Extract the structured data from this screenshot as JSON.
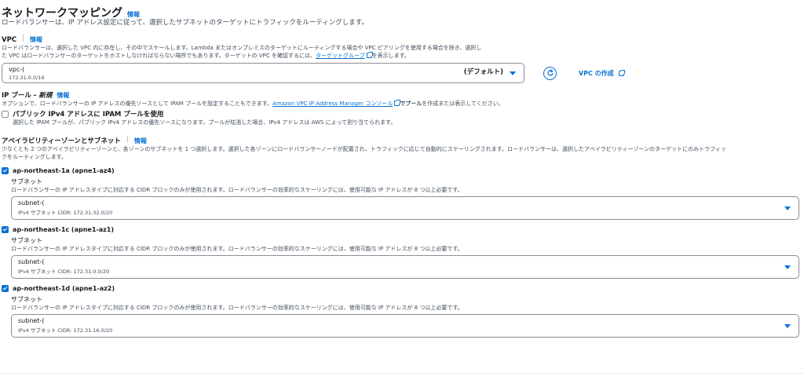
{
  "network_mapping": {
    "title": "ネットワークマッピング",
    "info": "情報",
    "description": "ロードバランサーは、IP アドレス設定に従って、選択したサブネットのターゲットにトラフィックをルーティングします。"
  },
  "vpc": {
    "label": "VPC",
    "info": "情報",
    "description_line1": "ロードバランサーは、選択した VPC 内に存在し、その中でスケールします。Lambda またはオンプレミスのターゲットにルーティングする場合や VPC ピアリングを使用する場合を除き、選択し",
    "description_line2_pre": "た VPC はロードバランサーのターゲットをホストしなければならない場所でもあります。ターゲットの VPC を確認するには、",
    "target_group_link": "ターゲットグループ",
    "description_line2_post": "を表示します。",
    "selected_value": "vpc-(",
    "selected_cidr": "172.31.0.0/16",
    "default_tag": "(デフォルト)",
    "create_link": "VPC の作成"
  },
  "ip_pool": {
    "label": "IP プール - ",
    "label_new": "新規",
    "info": "情報",
    "description_pre": "オプションで、ロードバランサーの IP アドレスの優先ソースとして IPAM プールを設定することもできます。",
    "ipam_link": "Amazon VPC IP Address Manager コンソール",
    "description_post_bold": "でプール",
    "description_post": "を作成または表示してください。",
    "checkbox_label": "パブリック IPv4 アドレスに IPAM プールを使用",
    "checkbox_desc": "選択した IPAM プールが、パブリック IPv4 アドレスの優先ソースになります。プールが枯渇した場合、IPv4 アドレスは AWS によって割り当てられます。"
  },
  "az": {
    "label": "アベイラビリティーゾーンとサブネット",
    "info": "情報",
    "description_line1": "少なくとも 2 つのアベイラビリティーゾーンと、各ゾーンのサブネットを 1 つ選択します。選択した各ゾーンにロードバランサーノードが配置され、トラフィックに応じて自動的にスケーリングされます。ロードバランサーは、選択したアベイラビリティーゾーンのターゲットにのみトラフィッ",
    "description_line2": "クをルーティングします。",
    "subnet_label": "サブネット",
    "subnet_desc": "ロードバランサーの IP アドレスタイプに対応する CIDR ブロックのみが使用されます。ロードバランサーの効率的なスケーリングには、使用可能な IP アドレスが 8 つ以上必要です。",
    "zones": [
      {
        "name": "ap-northeast-1a (apne1-az4)",
        "subnet": "subnet-(",
        "cidr": "IPv4 サブネット CIDR: 172.31.32.0/20"
      },
      {
        "name": "ap-northeast-1c (apne1-az1)",
        "subnet": "subnet-(",
        "cidr": "IPv4 サブネット CIDR: 172.31.0.0/20"
      },
      {
        "name": "ap-northeast-1d (apne1-az2)",
        "subnet": "subnet-(",
        "cidr": "IPv4 サブネット CIDR: 172.31.16.0/20"
      }
    ]
  },
  "colors": {
    "accent": "#0972d3",
    "text": "#16191f",
    "muted": "#414d5c",
    "border": "#8c8c94"
  }
}
